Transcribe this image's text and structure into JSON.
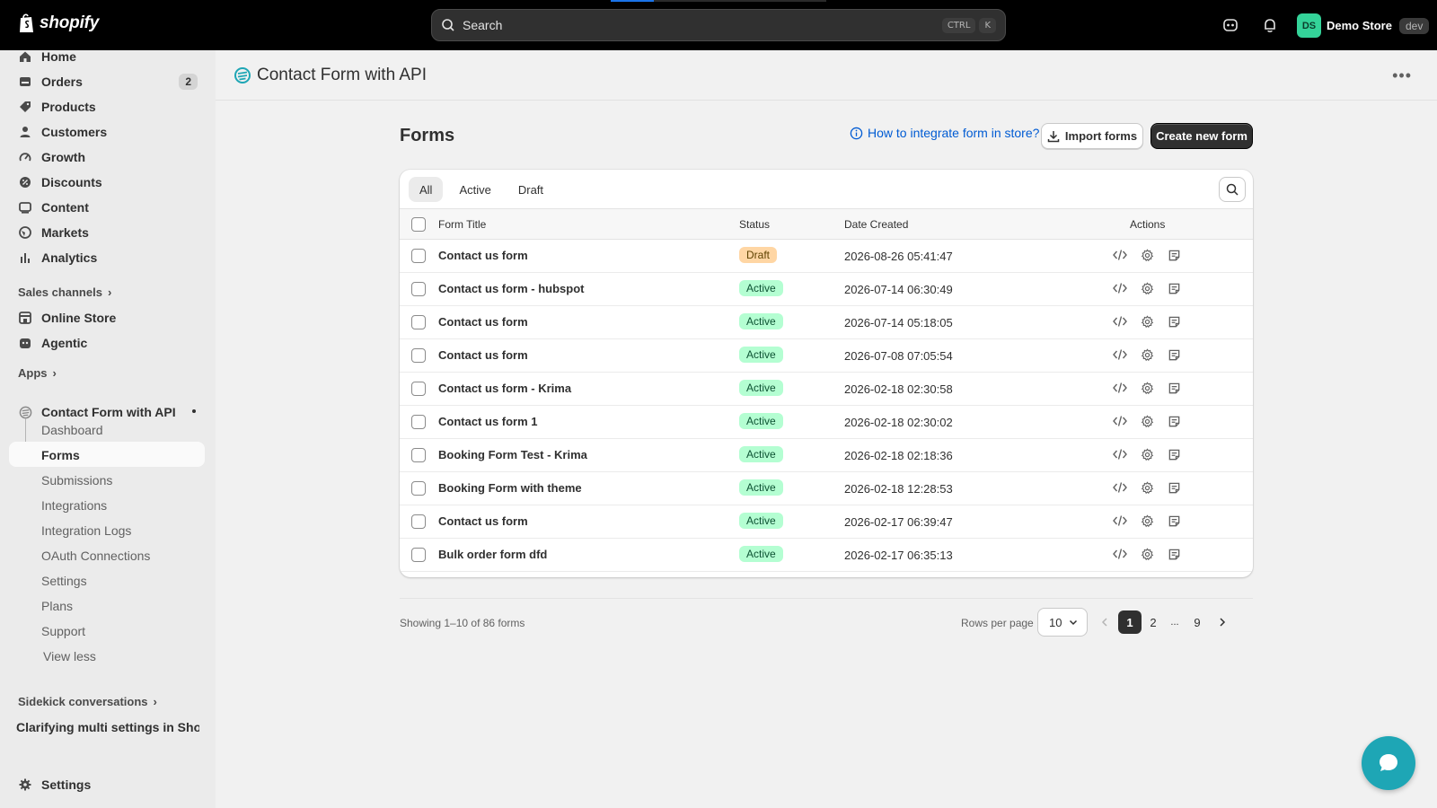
{
  "topbar": {
    "brand": "shopify",
    "search_placeholder": "Search",
    "shortcut_ctrl": "CTRL",
    "shortcut_key": "K",
    "store_initials": "DS",
    "store_name": "Demo Store",
    "store_env": "dev"
  },
  "sidebar": {
    "main": [
      {
        "label": "Home",
        "icon": "home-icon"
      },
      {
        "label": "Orders",
        "icon": "orders-icon",
        "badge": "2"
      },
      {
        "label": "Products",
        "icon": "tag-icon"
      },
      {
        "label": "Customers",
        "icon": "person-icon"
      },
      {
        "label": "Growth",
        "icon": "gauge-icon"
      },
      {
        "label": "Discounts",
        "icon": "discount-icon"
      },
      {
        "label": "Content",
        "icon": "content-icon"
      },
      {
        "label": "Markets",
        "icon": "globe-icon"
      },
      {
        "label": "Analytics",
        "icon": "bar-chart-icon"
      }
    ],
    "sales_channels_label": "Sales channels",
    "channels": [
      {
        "label": "Online Store",
        "icon": "store-icon"
      },
      {
        "label": "Agentic",
        "icon": "agentic-icon"
      }
    ],
    "apps_label": "Apps",
    "app_name": "Contact Form with API",
    "app_subitems": [
      "Dashboard",
      "Forms",
      "Submissions",
      "Integrations",
      "Integration Logs",
      "OAuth Connections",
      "Settings",
      "Plans",
      "Support",
      "View less"
    ],
    "active_subitem": "Forms",
    "sidekick_label": "Sidekick conversations",
    "sidekick_recent": "Clarifying multi settings in Sho...",
    "settings_label": "Settings"
  },
  "app_header": {
    "title": "Contact Form with API"
  },
  "page": {
    "title": "Forms",
    "help_link": "How to integrate form in store?",
    "import_button": "Import forms",
    "create_button": "Create new form"
  },
  "tabs": [
    "All",
    "Active",
    "Draft"
  ],
  "selected_tab": "All",
  "table": {
    "columns": {
      "title": "Form Title",
      "status": "Status",
      "date": "Date Created",
      "actions": "Actions"
    },
    "rows": [
      {
        "title": "Contact us form",
        "status": "Draft",
        "date": "2026-08-26 05:41:47"
      },
      {
        "title": "Contact us form - hubspot",
        "status": "Active",
        "date": "2026-07-14 06:30:49"
      },
      {
        "title": "Contact us form",
        "status": "Active",
        "date": "2026-07-14 05:18:05"
      },
      {
        "title": "Contact us form",
        "status": "Active",
        "date": "2026-07-08 07:05:54"
      },
      {
        "title": "Contact us form - Krima",
        "status": "Active",
        "date": "2026-02-18 02:30:58"
      },
      {
        "title": "Contact us form 1",
        "status": "Active",
        "date": "2026-02-18 02:30:02"
      },
      {
        "title": "Booking Form Test - Krima",
        "status": "Active",
        "date": "2026-02-18 02:18:36"
      },
      {
        "title": "Booking Form with theme",
        "status": "Active",
        "date": "2026-02-18 12:28:53"
      },
      {
        "title": "Contact us form",
        "status": "Active",
        "date": "2026-02-17 06:39:47"
      },
      {
        "title": "Bulk order form dfd",
        "status": "Active",
        "date": "2026-02-17 06:35:13"
      }
    ]
  },
  "footer": {
    "showing": "Showing 1–10 of 86 forms",
    "rows_per_page_label": "Rows per page",
    "rows_per_page_value": "10",
    "pages": [
      "1",
      "2",
      "...",
      "9"
    ],
    "current_page": "1"
  },
  "colors": {
    "accent": "#303030",
    "link": "#005bd3",
    "active_badge": "#b4fed2",
    "draft_badge": "#ffd6a4",
    "chat": "#1ea6b5"
  }
}
